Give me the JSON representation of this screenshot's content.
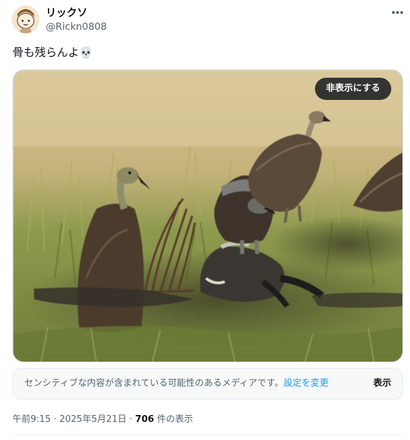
{
  "user": {
    "display_name": "リックソ",
    "handle": "@Rickn0808",
    "avatar_icon": "cartoon-avatar-icon"
  },
  "tweet": {
    "text": "骨も残らんよ💀"
  },
  "media": {
    "hide_label": "非表示にする",
    "subject": "vultures-feeding-on-carcass-photo"
  },
  "sensitive_notice": {
    "text": "センシティブな内容が含まれている可能性のあるメディアです。",
    "settings_link": "設定を変更",
    "show_label": "表示"
  },
  "meta": {
    "time": "午前9:15",
    "separator": " · ",
    "date": "2025年5月21日",
    "views_count": "706",
    "views_label": " 件の表示"
  },
  "colors": {
    "link": "#1d9bf0",
    "secondary_text": "#536471",
    "primary_text": "#0f1419"
  }
}
